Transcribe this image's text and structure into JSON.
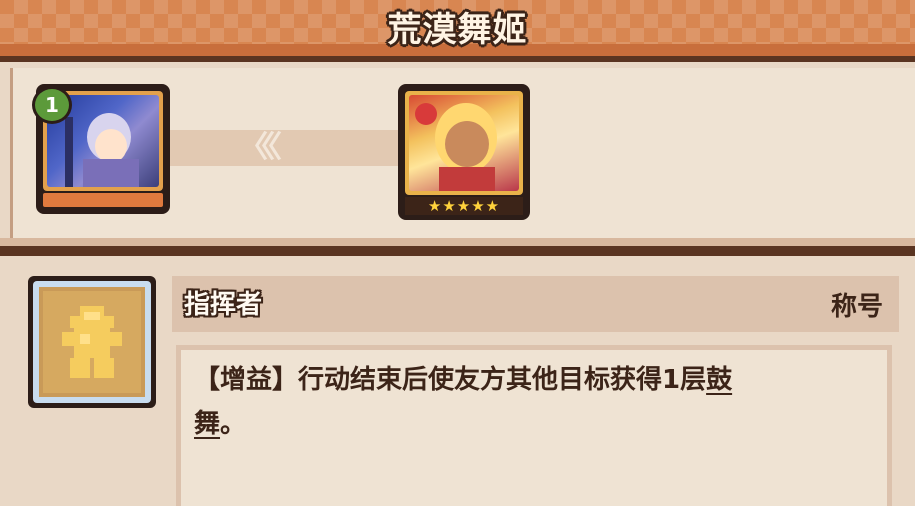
{
  "header": {
    "title": "荒漠舞姬"
  },
  "left_unit": {
    "level": "1",
    "icon": "knight-portrait"
  },
  "right_unit": {
    "stars": "★★★★★",
    "icon": "dancer-portrait"
  },
  "arrow_glyphs": "〈〈〈",
  "skill": {
    "icon": "emblem-icon",
    "name": "指挥者",
    "type": "称号",
    "description_prefix": "【增益】行动结束后使友方其他目标获得1层",
    "keyword_line1": "鼓",
    "keyword_line2": "舞",
    "description_suffix": "。"
  },
  "colors": {
    "header": "#d88651",
    "dark_outline": "#3c2418",
    "panel": "#efe3d3",
    "level_badge": "#5c9a3a",
    "star": "#ffd23c"
  }
}
